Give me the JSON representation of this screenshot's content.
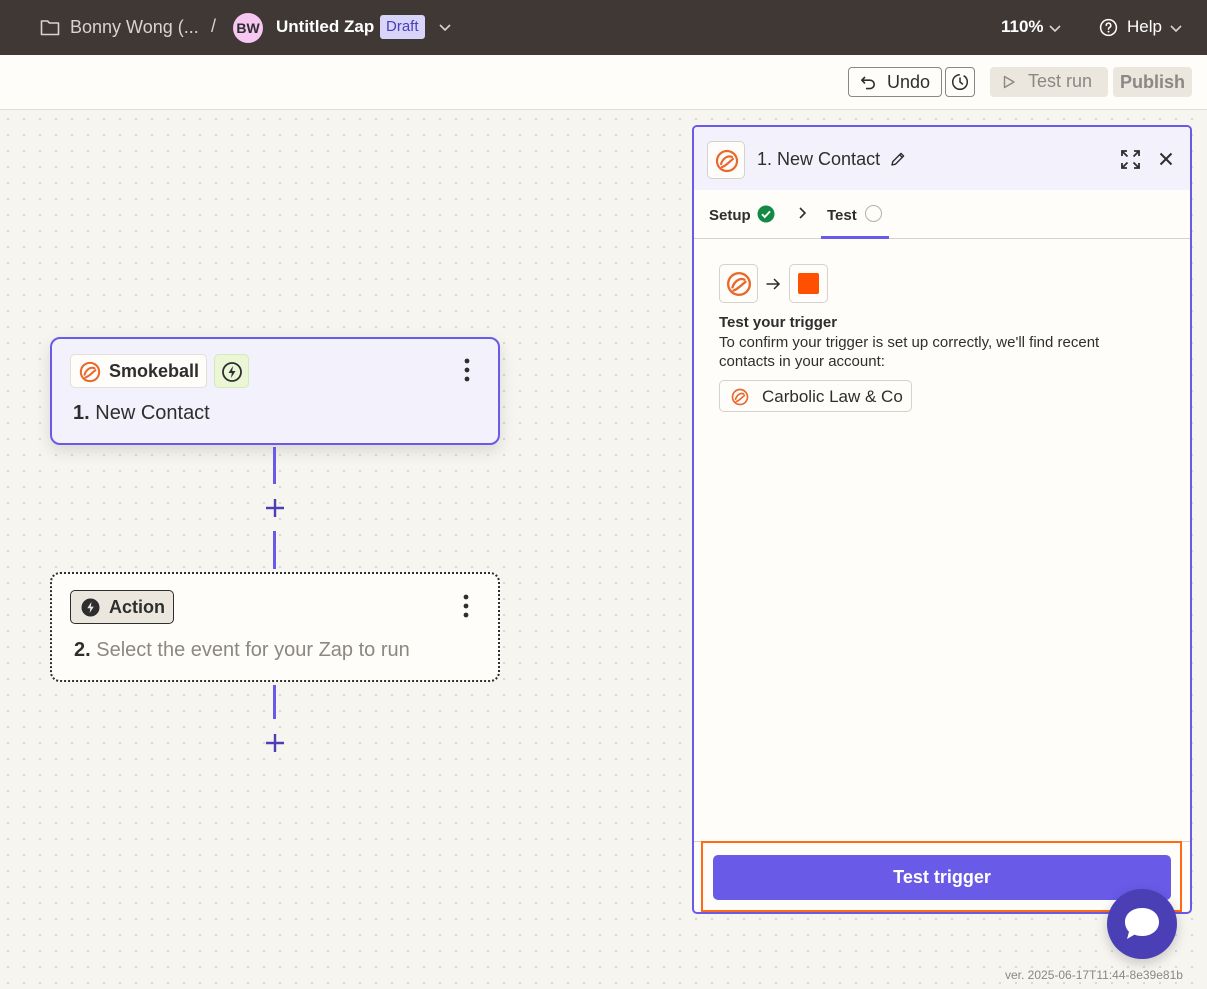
{
  "topbar": {
    "folder_name": "Bonny Wong (...",
    "separator": "/",
    "avatar_initials": "BW",
    "zap_name": "Untitled Zap",
    "status_badge": "Draft",
    "zoom": "110%",
    "help": "Help",
    "background": "#403835"
  },
  "toolbar": {
    "undo_label": "Undo",
    "test_run_label": "Test run",
    "publish_label": "Publish"
  },
  "canvas": {
    "trigger_step": {
      "app_name": "Smokeball",
      "number": "1.",
      "title": "New Contact"
    },
    "action_step": {
      "chip_label": "Action",
      "number": "2.",
      "placeholder": "Select the event for your Zap to run"
    }
  },
  "panel": {
    "number": "1.",
    "title": "New Contact",
    "tabs": [
      {
        "label": "Setup",
        "status": "complete"
      },
      {
        "label": "Test",
        "status": "pending",
        "active": true
      }
    ],
    "test_heading": "Test your trigger",
    "test_description": "To confirm your trigger is set up correctly, we'll find recent contacts in your account:",
    "account_name": "Carbolic Law & Co",
    "test_button_label": "Test trigger"
  },
  "colors": {
    "accent": "#695be8",
    "smokeball_orange": "#e8682d",
    "zapier_orange": "#ff4f00",
    "success_green": "#138a43",
    "highlight_orange": "#ff6a13"
  },
  "version": "ver. 2025-06-17T11:44-8e39e81b"
}
